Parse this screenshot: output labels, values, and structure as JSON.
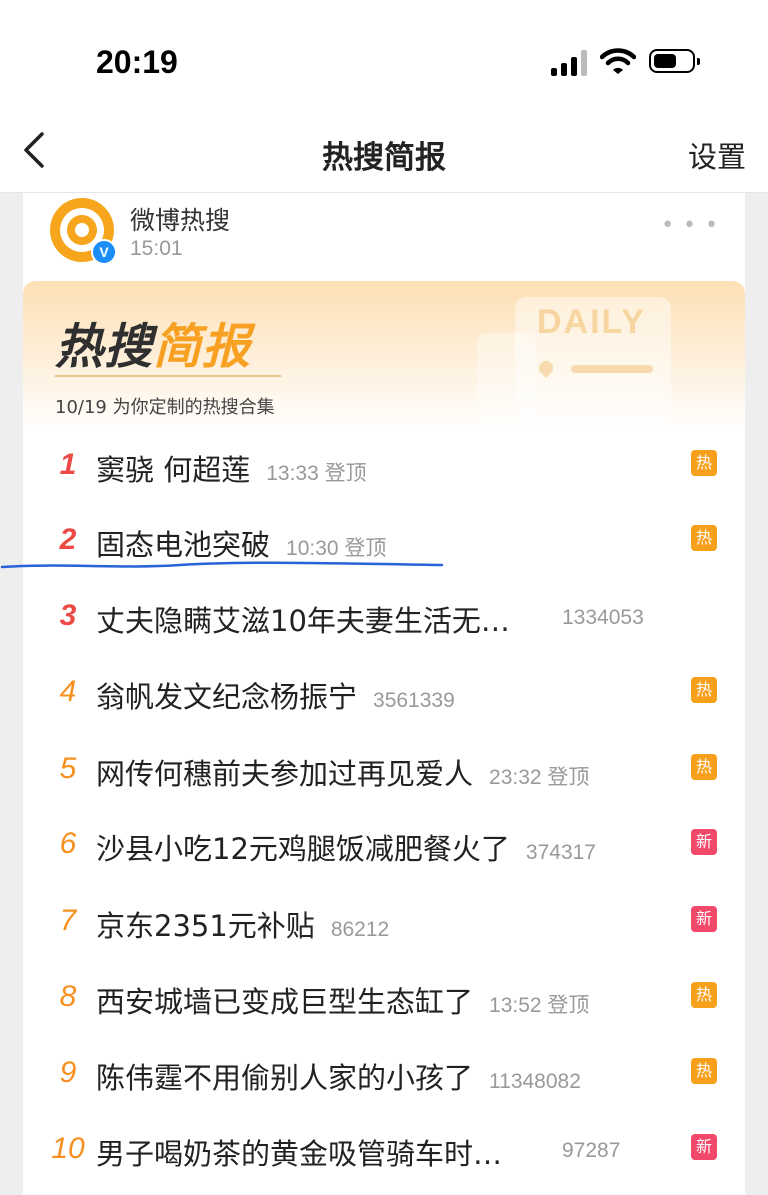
{
  "status_bar": {
    "time": "20:19"
  },
  "nav": {
    "title": "热搜简报",
    "settings": "设置"
  },
  "account": {
    "name": "微博热搜",
    "time": "15:01",
    "verified": "V"
  },
  "banner": {
    "title_a": "热搜",
    "title_b": "简报",
    "subtitle": "10/19 为你定制的热搜合集",
    "deco_label": "DAILY"
  },
  "colors": {
    "rank_top": "#ec4a45",
    "rank_other": "#f7901e",
    "hot_tag": "#f7a01c",
    "new_tag": "#f2486a",
    "accent": "#f7a021"
  },
  "items": [
    {
      "rank": "1",
      "title": "窦骁 何超莲",
      "meta": "13:33 登顶",
      "tag": "热"
    },
    {
      "rank": "2",
      "title": "固态电池突破",
      "meta": "10:30 登顶",
      "tag": "热"
    },
    {
      "rank": "3",
      "title": "丈夫隐瞒艾滋10年夫妻生活无…",
      "meta": "1334053",
      "tag": ""
    },
    {
      "rank": "4",
      "title": "翁帆发文纪念杨振宁",
      "meta": "3561339",
      "tag": "热"
    },
    {
      "rank": "5",
      "title": "网传何穗前夫参加过再见爱人",
      "meta": "23:32 登顶",
      "tag": "热"
    },
    {
      "rank": "6",
      "title": "沙县小吃12元鸡腿饭减肥餐火了",
      "meta": "374317",
      "tag": "新"
    },
    {
      "rank": "7",
      "title": "京东2351元补贴",
      "meta": "86212",
      "tag": "新"
    },
    {
      "rank": "8",
      "title": "西安城墙已变成巨型生态缸了",
      "meta": "13:52 登顶",
      "tag": "热"
    },
    {
      "rank": "9",
      "title": "陈伟霆不用偷别人家的小孩了",
      "meta": "11348082",
      "tag": "热"
    },
    {
      "rank": "10",
      "title": "男子喝奶茶的黄金吸管骑车时…",
      "meta": "97287",
      "tag": "新"
    }
  ]
}
